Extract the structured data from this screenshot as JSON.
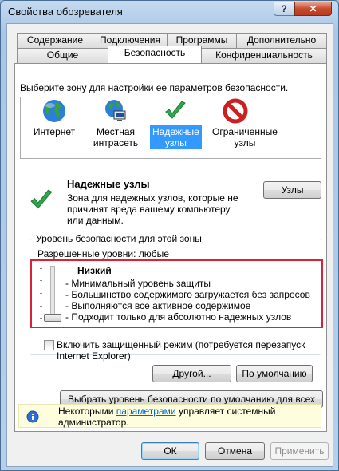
{
  "window": {
    "title": "Свойства обозревателя",
    "help_label": "?",
    "close_label": "✕"
  },
  "tabs_row1": [
    "Содержание",
    "Подключения",
    "Программы",
    "Дополнительно"
  ],
  "tabs_row2": [
    "Общие",
    "Безопасность",
    "Конфиденциальность"
  ],
  "panel": {
    "zone_prompt": "Выберите зону для настройки ее параметров безопасности.",
    "zones": [
      {
        "label": "Интернет",
        "icon": "globe-icon"
      },
      {
        "label": "Местная интрасеть",
        "icon": "intranet-icon"
      },
      {
        "label": "Надежные узлы",
        "icon": "checkmark-icon"
      },
      {
        "label": "Ограниченные узлы",
        "icon": "restricted-icon"
      }
    ],
    "selected_zone_title": "Надежные узлы",
    "selected_zone_desc": "Зона для надежных узлов, которые не причинят вреда вашему компьютеру или данным.",
    "sites_button": "Узлы",
    "level_group_title": "Уровень безопасности для этой зоны",
    "allowed_levels": "Разрешенные уровни: любые",
    "level_name": "Низкий",
    "level_items": [
      "- Минимальный уровень защиты",
      "- Большинство содержимого загружается без запросов",
      "- Выполняются все активное содержимое",
      "- Подходит только для абсолютно надежных узлов"
    ],
    "protected_mode_label": "Включить защищенный режим (потребуется перезапуск Internet Explorer)",
    "custom_button": "Другой...",
    "default_button": "По умолчанию",
    "reset_all_button": "Выбрать уровень безопасности по умолчанию для всех зон",
    "info_prefix": "Некоторыми ",
    "info_link": "параметрами",
    "info_suffix": " управляет системный администратор."
  },
  "footer": {
    "ok": "ОК",
    "cancel": "Отмена",
    "apply": "Применить"
  },
  "colors": {
    "selection": "#3399ff",
    "highlight_border": "#d9213a",
    "info_background": "#fefedf"
  }
}
